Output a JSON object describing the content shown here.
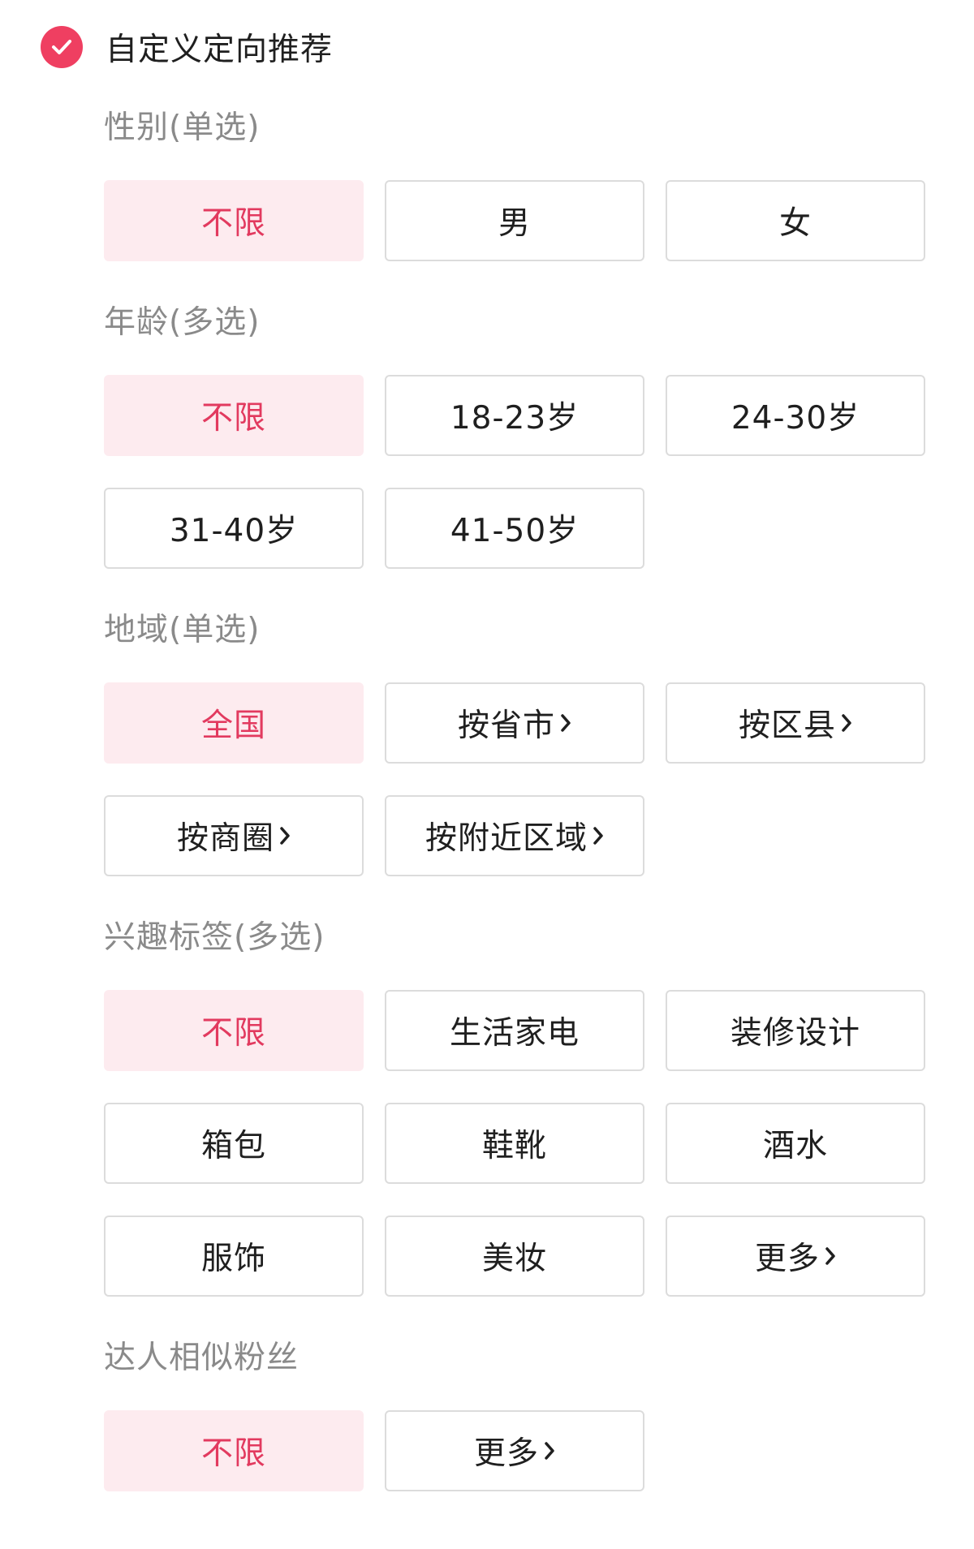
{
  "header": {
    "title": "自定义定向推荐",
    "checked": true,
    "accent_color": "#ef3f61",
    "check_icon": "check-circle-icon"
  },
  "theme": {
    "selected_bg": "#fdebef",
    "selected_text": "#e23a5f",
    "section_title_color": "#8a8a8a",
    "border_color": "#dcdcdc"
  },
  "sections": {
    "gender": {
      "title": "性别(单选)",
      "options": [
        {
          "label": "不限",
          "selected": true
        },
        {
          "label": "男",
          "selected": false
        },
        {
          "label": "女",
          "selected": false
        }
      ]
    },
    "age": {
      "title": "年龄(多选)",
      "options": [
        {
          "label": "不限",
          "selected": true
        },
        {
          "label": "18-23岁",
          "selected": false
        },
        {
          "label": "24-30岁",
          "selected": false
        },
        {
          "label": "31-40岁",
          "selected": false
        },
        {
          "label": "41-50岁",
          "selected": false
        }
      ]
    },
    "region": {
      "title": "地域(单选)",
      "options": [
        {
          "label": "全国",
          "selected": true,
          "has_arrow": false
        },
        {
          "label": "按省市",
          "selected": false,
          "has_arrow": true
        },
        {
          "label": "按区县",
          "selected": false,
          "has_arrow": true
        },
        {
          "label": "按商圈",
          "selected": false,
          "has_arrow": true
        },
        {
          "label": "按附近区域",
          "selected": false,
          "has_arrow": true
        }
      ]
    },
    "interests": {
      "title": "兴趣标签(多选)",
      "options": [
        {
          "label": "不限",
          "selected": true,
          "has_arrow": false
        },
        {
          "label": "生活家电",
          "selected": false,
          "has_arrow": false
        },
        {
          "label": "装修设计",
          "selected": false,
          "has_arrow": false
        },
        {
          "label": "箱包",
          "selected": false,
          "has_arrow": false
        },
        {
          "label": "鞋靴",
          "selected": false,
          "has_arrow": false
        },
        {
          "label": "酒水",
          "selected": false,
          "has_arrow": false
        },
        {
          "label": "服饰",
          "selected": false,
          "has_arrow": false
        },
        {
          "label": "美妆",
          "selected": false,
          "has_arrow": false
        },
        {
          "label": "更多",
          "selected": false,
          "has_arrow": true
        }
      ]
    },
    "similar_fans": {
      "title": "达人相似粉丝",
      "options": [
        {
          "label": "不限",
          "selected": true,
          "has_arrow": false
        },
        {
          "label": "更多",
          "selected": false,
          "has_arrow": true
        }
      ]
    }
  }
}
